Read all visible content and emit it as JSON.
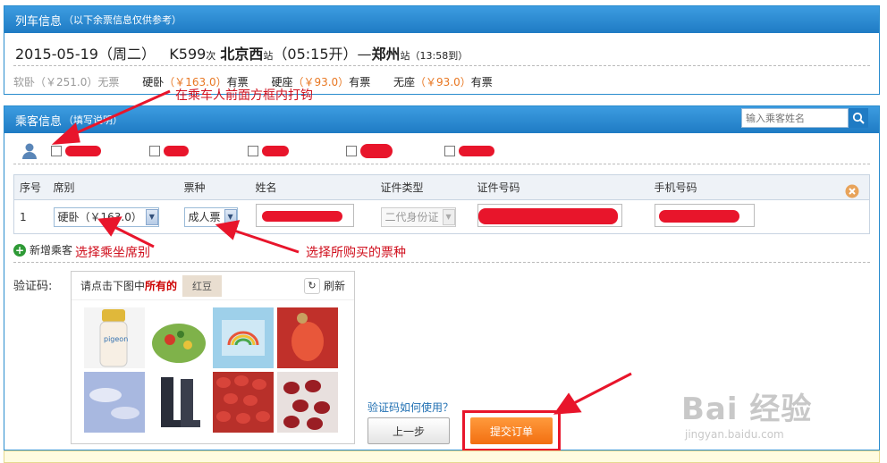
{
  "train_info": {
    "header_title": "列车信息",
    "header_note": "（以下余票信息仅供参考）",
    "date": "2015-05-19（周二）",
    "train_no": "K599",
    "train_suffix": "次",
    "from_station": "北京西",
    "station_suffix": "站",
    "depart": "（05:15开）—",
    "to_station": "郑州",
    "to_suffix": "站",
    "arrive": "（13:58到）",
    "seats": [
      {
        "name": "软卧",
        "price": "（￥251.0）",
        "status": "无票",
        "available": false
      },
      {
        "name": "硬卧",
        "price": "（￥163.0）",
        "status": "有票",
        "available": true
      },
      {
        "name": "硬座",
        "price": "（￥93.0）",
        "status": "有票",
        "available": true
      },
      {
        "name": "无座",
        "price": "（￥93.0）",
        "status": "有票",
        "available": true
      }
    ]
  },
  "passenger_info": {
    "header_title": "乘客信息",
    "header_note": "（填写说明）",
    "search_placeholder": "输入乘客姓名",
    "table_headers": [
      "序号",
      "席别",
      "票种",
      "姓名",
      "证件类型",
      "证件号码",
      "手机号码"
    ],
    "row": {
      "index": "1",
      "seat": "硬卧（￥163.0）",
      "ticket_type": "成人票",
      "id_type": "二代身份证"
    },
    "add_passenger": "新增乘客"
  },
  "captcha": {
    "label": "验证码:",
    "prompt_prefix": "请点击下图中",
    "prompt_highlight": "所有的",
    "sample_word": "红豆",
    "refresh": "刷新",
    "tiles": [
      "baby-bottle",
      "salad",
      "rainbow-card",
      "red-bean-macro",
      "sky",
      "rain-boots",
      "red-beans",
      "red-beans-dark"
    ]
  },
  "actions": {
    "help_link": "验证码如何使用？",
    "prev_button": "上一步",
    "submit_button": "提交订单"
  },
  "annotations": {
    "check_box": "在乘车人前面方框内打钩",
    "choose_seat": "选择乘坐席别",
    "choose_ticket": "选择所购买的票种"
  },
  "watermark": {
    "main": "Bai 经验",
    "url": "jingyan.baidu.com"
  },
  "colors": {
    "header_blue": "#1f7bc4",
    "price_orange": "#e87722",
    "annotation_red": "#d0101e",
    "submit_orange": "#f26f11"
  }
}
